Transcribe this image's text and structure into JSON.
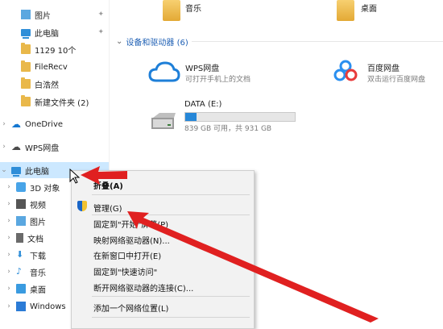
{
  "nav": {
    "items": [
      {
        "label": "图片",
        "pinned": true,
        "icon": "pictures-folder-icon"
      },
      {
        "label": "此电脑",
        "pinned": true,
        "icon": "computer-icon"
      },
      {
        "label": "1129 10个",
        "icon": "folder-icon"
      },
      {
        "label": "FileRecv",
        "icon": "folder-icon"
      },
      {
        "label": "白浩然",
        "icon": "folder-icon"
      },
      {
        "label": "新建文件夹 (2)",
        "icon": "folder-icon"
      },
      {
        "label": "OneDrive",
        "icon": "onedrive-cloud-icon"
      },
      {
        "label": "WPS网盘",
        "icon": "wps-cloud-icon"
      },
      {
        "label": "此电脑",
        "icon": "computer-icon",
        "selected": true
      },
      {
        "label": "3D 对象",
        "icon": "3d-objects-icon"
      },
      {
        "label": "视频",
        "icon": "video-folder-icon"
      },
      {
        "label": "图片",
        "icon": "pictures-folder-icon"
      },
      {
        "label": "文档",
        "icon": "documents-folder-icon"
      },
      {
        "label": "下载",
        "icon": "downloads-folder-icon"
      },
      {
        "label": "音乐",
        "icon": "music-folder-icon"
      },
      {
        "label": "桌面",
        "icon": "desktop-folder-icon"
      },
      {
        "label": "Windows",
        "icon": "windows-drive-icon"
      }
    ]
  },
  "main": {
    "folders": [
      {
        "label": "音乐"
      },
      {
        "label": "桌面"
      }
    ],
    "section_title": "设备和驱动器 (6)",
    "drives": [
      {
        "title": "WPS网盘",
        "subtitle": "可打开手机上的文档"
      },
      {
        "title": "百度网盘",
        "subtitle": "双击运行百度网盘"
      },
      {
        "title": "DATA (E:)",
        "subtitle": "839 GB 可用，共 931 GB",
        "used_fraction": 0.1
      }
    ]
  },
  "context_menu": {
    "items": [
      "折叠(A)",
      "管理(G)",
      "固定到\"开始\"屏幕(P)",
      "映射网络驱动器(N)...",
      "在新窗口中打开(E)",
      "固定到\"快速访问\"",
      "断开网络驱动器的连接(C)...",
      "添加一个网络位置(L)"
    ]
  },
  "colors": {
    "selection": "#cce8ff",
    "accent": "#2687d8",
    "annotation_red": "#e02020"
  }
}
